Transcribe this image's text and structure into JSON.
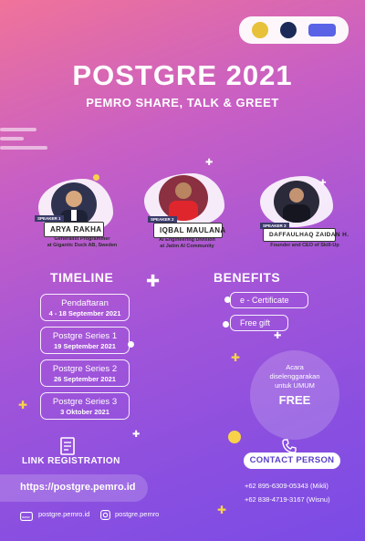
{
  "header": {
    "title": "POSTGRE 2021",
    "subtitle": "PEMRO SHARE, TALK & GREET"
  },
  "speakers": [
    {
      "tag": "SPEAKER 1",
      "name": "ARYA RAKHA",
      "role_line1": "Generalist Programmer",
      "role_line2": "at Gigantic Duck AB, Sweden"
    },
    {
      "tag": "SPEAKER 2",
      "name": "IQBAL MAULANA",
      "role_line1": "AI Engineering Division",
      "role_line2": "at Jatim AI Community"
    },
    {
      "tag": "SPEAKER 3",
      "name": "DAFFAULHAQ ZAIDAN H.",
      "role_line1": "Founder and CEO of Skill-Up",
      "role_line2": ""
    }
  ],
  "timeline": {
    "heading": "TIMELINE",
    "items": [
      {
        "label": "Pendaftaran",
        "date": "4 - 18 September 2021"
      },
      {
        "label": "Postgre Series 1",
        "date": "19 September 2021"
      },
      {
        "label": "Postgre Series 2",
        "date": "26 September 2021"
      },
      {
        "label": "Postgre Series 3",
        "date": "3 Oktober 2021"
      }
    ]
  },
  "benefits": {
    "heading": "BENEFITS",
    "items": [
      "e - Certificate",
      "Free gift"
    ]
  },
  "free": {
    "line1": "Acara",
    "line2": "diselenggarakan",
    "line3": "untuk UMUM",
    "big": "FREE"
  },
  "registration": {
    "heading": "LINK REGISTRATION",
    "url": "https://postgre.pemro.id"
  },
  "contact": {
    "heading": "CONTACT PERSON",
    "phone1": "+62 895-6309-05343 (Mikli)",
    "phone2": "+62 838-4719-3167 (Wisnu)"
  },
  "footer": {
    "website": "postgre.pemro.id",
    "instagram": "postgre.pemro"
  },
  "colors": {
    "accent_yellow": "#f8d34a",
    "bg_pink": "#f0739a",
    "bg_purple": "#7a4be6"
  }
}
